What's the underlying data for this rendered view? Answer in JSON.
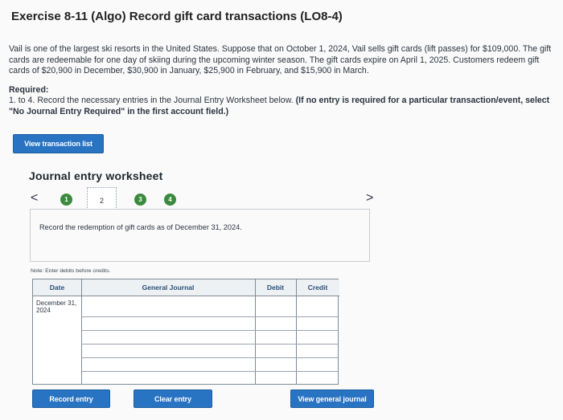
{
  "header": {
    "title": "Exercise 8-11 (Algo) Record gift card transactions (LO8-4)"
  },
  "problem": {
    "intro": "Vail is one of the largest ski resorts in the United States. Suppose that on October 1, 2024, Vail sells gift cards (lift passes) for $109,000. The gift cards are redeemable for one day of skiing during the upcoming winter season. The gift cards expire on April 1, 2025. Customers redeem gift cards of $20,900 in December, $30,900 in January, $25,900 in February, and $15,900 in March.",
    "required_label": "Required:",
    "required_text": "1. to 4. Record the necessary entries in the Journal Entry Worksheet below.",
    "required_bold": "(If no entry is required for a particular transaction/event, select \"No Journal Entry Required\" in the first account field.)"
  },
  "buttons": {
    "view_transaction_list": "View transaction list",
    "record_entry": "Record entry",
    "clear_entry": "Clear entry",
    "view_general_journal": "View general journal"
  },
  "worksheet": {
    "title": "Journal entry worksheet",
    "nav_prev": "<",
    "nav_next": ">",
    "steps": [
      "1",
      "2",
      "3",
      "4"
    ],
    "current_step": "2",
    "instruction": "Record the redemption of gift cards as of December 31, 2024.",
    "note": "Note: Enter debits before credits."
  },
  "table": {
    "headers": {
      "date": "Date",
      "general_journal": "General Journal",
      "debit": "Debit",
      "credit": "Credit"
    },
    "date_value": "December 31, 2024",
    "rows": [
      {
        "account": "",
        "debit": "",
        "credit": ""
      },
      {
        "account": "",
        "debit": "",
        "credit": ""
      },
      {
        "account": "",
        "debit": "",
        "credit": ""
      },
      {
        "account": "",
        "debit": "",
        "credit": ""
      },
      {
        "account": "",
        "debit": "",
        "credit": ""
      },
      {
        "account": "",
        "debit": "",
        "credit": ""
      }
    ]
  },
  "colors": {
    "button_blue": "#2873c2",
    "step_green": "#3b8a3e"
  }
}
